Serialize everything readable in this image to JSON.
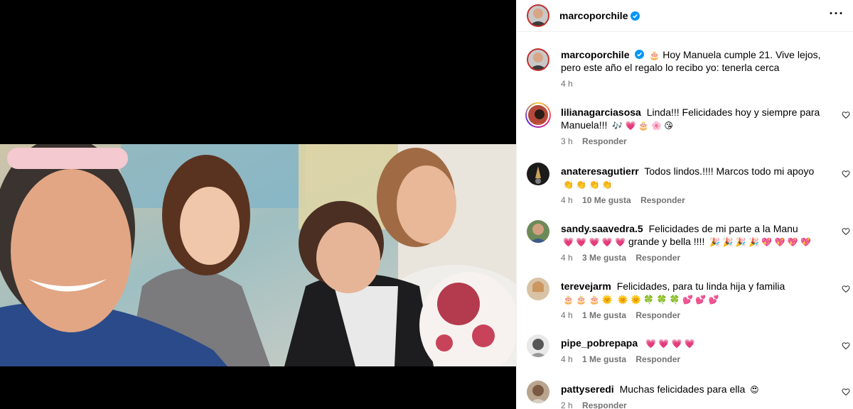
{
  "post": {
    "author": "marcoporchile",
    "caption_emoji": "🎂",
    "caption": "Hoy Manuela cumple 21. Vive lejos, pero este año el regalo lo recibo yo: tenerla cerca",
    "time": "4 h"
  },
  "header": {
    "more_label": "···"
  },
  "colors": {
    "verified": "#0095f6",
    "muted": "#737373"
  },
  "comments": [
    {
      "user": "lilianagarciasosa",
      "text": "Linda!!! Felicidades hoy y siempre para Manuela!!!",
      "emojis": "🎶 💗 🎂 🌸 😘",
      "time": "3 h",
      "likes": "",
      "reply": "Responder"
    },
    {
      "user": "anateresagutierr",
      "text": "Todos lindos.!!!! Marcos todo mi apoyo",
      "emojis": "👏 👏 👏 👏",
      "time": "4 h",
      "likes": "10 Me gusta",
      "reply": "Responder"
    },
    {
      "user": "sandy.saavedra.5",
      "text": "Felicidades de mi parte a la Manu",
      "emojis": "💗 💗 💗 💗 💗",
      "text2": "grande y bella !!!!",
      "emojis2": "🎉 🎉 🎉 🎉 💖 💖 💖 💖",
      "time": "4 h",
      "likes": "3 Me gusta",
      "reply": "Responder"
    },
    {
      "user": "terevejarm",
      "text": "Felicidades, para tu linda hija y familia",
      "emojis": "🎂 🎂 🎂 🌞",
      "emojis2": "🌞 🌞 🍀 🍀 🍀 💕 💕 💕",
      "time": "4 h",
      "likes": "1 Me gusta",
      "reply": "Responder"
    },
    {
      "user": "pipe_pobrepapa",
      "text": "",
      "emojis": "💗 💗 💗 💗",
      "time": "4 h",
      "likes": "1 Me gusta",
      "reply": "Responder"
    },
    {
      "user": "pattyseredi",
      "text": "Muchas felicidades para ella",
      "emojis": "😍",
      "time": "2 h",
      "likes": "",
      "reply": "Responder"
    }
  ]
}
